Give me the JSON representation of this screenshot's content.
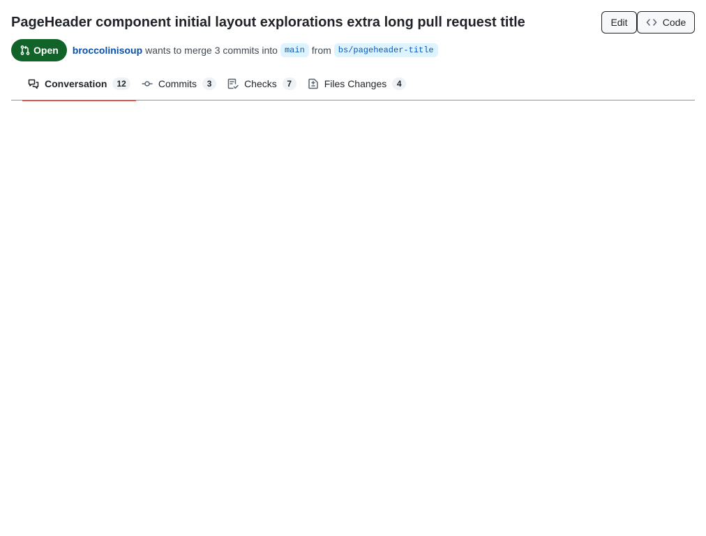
{
  "header": {
    "title": "PageHeader component initial layout explorations extra long pull request title",
    "actions": {
      "edit_label": "Edit",
      "code_label": "Code",
      "code_icon": "code-icon"
    }
  },
  "meta": {
    "state_label": "Open",
    "state_icon": "git-pull-request-icon",
    "state_color": "#116329",
    "author": "broccolinisoup",
    "text_before_base": "wants to merge 3 commits into",
    "base_branch": "main",
    "text_from": "from",
    "head_branch": "bs/pageheader-title"
  },
  "tabs": [
    {
      "label": "Conversation",
      "count": "12",
      "icon": "comment-discussion-icon",
      "selected": true
    },
    {
      "label": "Commits",
      "count": "3",
      "icon": "git-commit-icon",
      "selected": false
    },
    {
      "label": "Checks",
      "count": "7",
      "icon": "checklist-icon",
      "selected": false
    },
    {
      "label": "Files Changes",
      "count": "4",
      "icon": "file-diff-icon",
      "selected": false
    }
  ],
  "colors": {
    "accent_underline": "#e5534b",
    "author_link": "#0a4fa8",
    "branch_bg": "#ddf4ff",
    "branch_text": "#0b56b5"
  }
}
